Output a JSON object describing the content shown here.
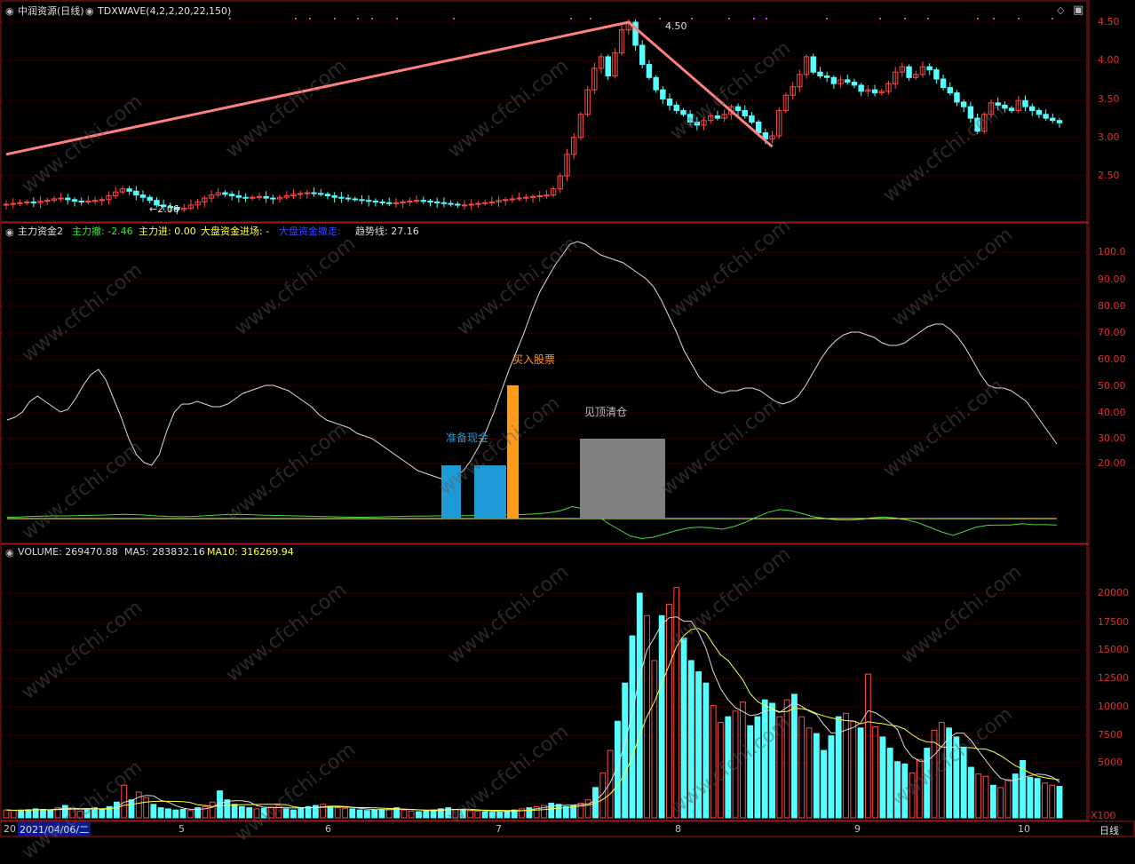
{
  "main_panel": {
    "title": "中润资源(日线)",
    "indicator": "TDXWAVE(4,2,2,20,22,150)",
    "high_label": "4.50",
    "low_label": "2.06",
    "y_ticks": [
      "4.50",
      "4.00",
      "3.50",
      "3.00",
      "2.50"
    ]
  },
  "fund_panel": {
    "name": "主力资金2",
    "items": [
      {
        "label": "主力撤:",
        "value": "-2.46",
        "color": "#33ee33"
      },
      {
        "label": "主力进:",
        "value": "0.00",
        "color": "#ffff44"
      },
      {
        "label": "大盘资金进场:",
        "value": "-",
        "color": "#ffff44"
      },
      {
        "label": "大盘资金撤走:",
        "value": "",
        "color": "#3344ff"
      },
      {
        "label": "趋势线:",
        "value": "27.16",
        "color": "#dddddd"
      }
    ],
    "y_ticks": [
      "100.0",
      "90.00",
      "80.00",
      "70.00",
      "60.00",
      "50.00",
      "40.00",
      "30.00",
      "20.00"
    ],
    "annotations": {
      "prepare_cash": "准备现金",
      "buy_stock": "买入股票",
      "top_clear": "见顶清仓"
    }
  },
  "volume_panel": {
    "items": [
      {
        "label": "VOLUME:",
        "value": "269470.88",
        "color": "#dddddd"
      },
      {
        "label": "MA5:",
        "value": "283832.16",
        "color": "#dddddd"
      },
      {
        "label": "MA10:",
        "value": "316269.94",
        "color": "#ffff44"
      }
    ],
    "y_ticks": [
      "20000",
      "17500",
      "15000",
      "12500",
      "10000",
      "7500",
      "5000"
    ],
    "unit": "X100"
  },
  "time_axis": {
    "prefix": "20",
    "cursor_date": "2021/04/06/二",
    "months": [
      "5",
      "6",
      "7",
      "8",
      "9",
      "10"
    ],
    "period": "日线"
  },
  "watermark": "www.cfchi.com",
  "colors": {
    "up": "#ff4a4a",
    "down": "#55ffff",
    "wave": "#ff8080",
    "grid": "#8b0000",
    "prepare": "#1e9ad6",
    "buy": "#ff9a1a",
    "clear": "#808080",
    "trend": "#dddddd",
    "zero": "#ffff44",
    "fund": "#44dd44"
  }
}
